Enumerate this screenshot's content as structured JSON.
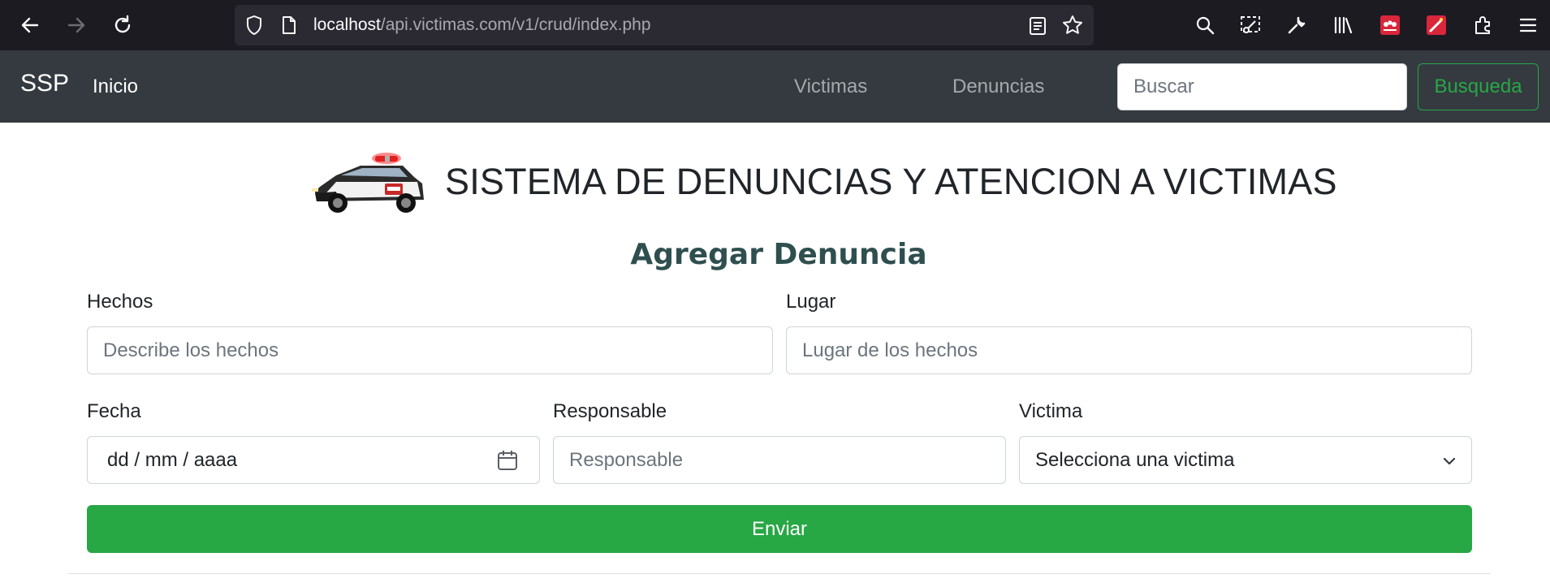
{
  "browser": {
    "url_host": "localhost",
    "url_path": "/api.victimas.com/v1/crud/index.php"
  },
  "navbar": {
    "brand": "SSP",
    "home": "Inicio",
    "links": [
      "Victimas",
      "Denuncias"
    ],
    "search_placeholder": "Buscar",
    "search_button": "Busqueda"
  },
  "page": {
    "title": "SISTEMA DE DENUNCIAS Y ATENCION A VICTIMAS",
    "form_title": "Agregar Denuncia"
  },
  "form": {
    "hechos_label": "Hechos",
    "hechos_placeholder": "Describe los hechos",
    "lugar_label": "Lugar",
    "lugar_placeholder": "Lugar de los hechos",
    "fecha_label": "Fecha",
    "fecha_value": "dd / mm / aaaa",
    "responsable_label": "Responsable",
    "responsable_placeholder": "Responsable",
    "victima_label": "Victima",
    "victima_selected": "Selecciona una victima",
    "submit": "Enviar"
  },
  "colors": {
    "navbar_bg": "#343a40",
    "accent_green": "#28a745",
    "form_title": "#2f4f4f"
  }
}
